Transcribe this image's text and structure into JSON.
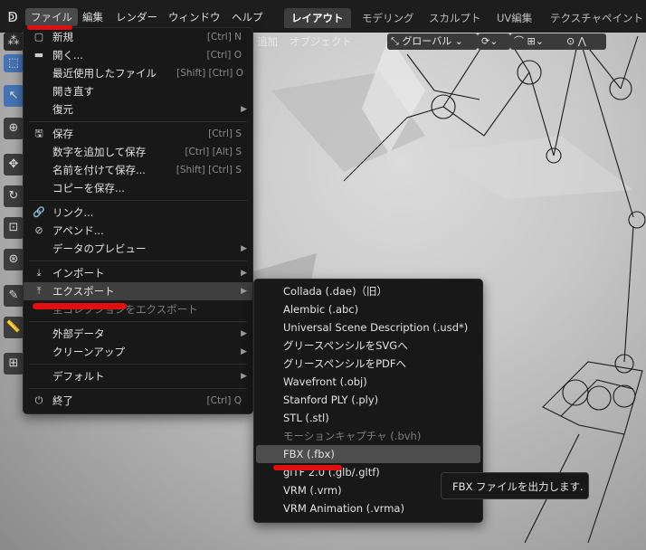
{
  "header": {
    "menus": [
      "ファイル",
      "編集",
      "レンダー",
      "ウィンドウ",
      "ヘルプ"
    ],
    "workspaces": [
      "レイアウト",
      "モデリング",
      "スカルプト",
      "UV編集",
      "テクスチャペイント"
    ]
  },
  "toolbar": {
    "add": "追加",
    "object": "オブジェクト",
    "orientation": "グローバル"
  },
  "file_menu": {
    "new": {
      "label": "新規",
      "shortcut": "[Ctrl] N"
    },
    "open": {
      "label": "開く...",
      "shortcut": "[Ctrl] O"
    },
    "recent": {
      "label": "最近使用したファイル",
      "shortcut": "[Shift] [Ctrl] O"
    },
    "revert": {
      "label": "開き直す"
    },
    "recover": {
      "label": "復元"
    },
    "save": {
      "label": "保存",
      "shortcut": "[Ctrl] S"
    },
    "save_incremental": {
      "label": "数字を追加して保存",
      "shortcut": "[Ctrl] [Alt] S"
    },
    "save_as": {
      "label": "名前を付けて保存...",
      "shortcut": "[Shift] [Ctrl] S"
    },
    "save_copy": {
      "label": "コピーを保存..."
    },
    "link": {
      "label": "リンク..."
    },
    "append": {
      "label": "アペンド..."
    },
    "data_previews": {
      "label": "データのプレビュー"
    },
    "import": {
      "label": "インポート"
    },
    "export": {
      "label": "エクスポート"
    },
    "export_collections": {
      "label": "全コレクションをエクスポート"
    },
    "external_data": {
      "label": "外部データ"
    },
    "cleanup": {
      "label": "クリーンアップ"
    },
    "defaults": {
      "label": "デフォルト"
    },
    "quit": {
      "label": "終了",
      "shortcut": "[Ctrl] Q"
    }
  },
  "export_submenu": [
    "Collada (.dae)（旧）",
    "Alembic (.abc)",
    "Universal Scene Description (.usd*)",
    "グリースペンシルをSVGへ",
    "グリースペンシルをPDFへ",
    "Wavefront (.obj)",
    "Stanford PLY (.ply)",
    "STL (.stl)",
    "モーションキャプチャ (.bvh)",
    "FBX (.fbx)",
    "glTF 2.0 (.glb/.gltf)",
    "VRM (.vrm)",
    "VRM Animation (.vrma)"
  ],
  "tooltip": "FBX ファイルを出力します.",
  "colors": {
    "accent": "#4772b3",
    "menu_bg": "#181818",
    "annotation_red": "#e00f0f",
    "topbar": "#1d1d1d"
  }
}
